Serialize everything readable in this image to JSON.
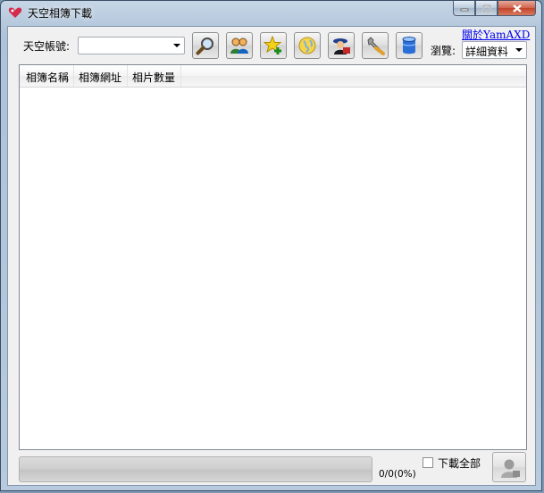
{
  "window": {
    "title": "天空相簿下載",
    "controls": [
      "minimize-icon",
      "maximize-icon",
      "close-icon"
    ]
  },
  "toolbar": {
    "account_label": "天空帳號:",
    "account_value": "",
    "buttons": [
      {
        "name": "search",
        "icon": "magnifier-icon"
      },
      {
        "name": "friends",
        "icon": "people-icon"
      },
      {
        "name": "favorite-add",
        "icon": "star-plus-icon"
      },
      {
        "name": "web",
        "icon": "globe-icon"
      },
      {
        "name": "user-agent",
        "icon": "agent-icon"
      },
      {
        "name": "settings",
        "icon": "wrench-icon"
      },
      {
        "name": "storage",
        "icon": "database-icon"
      }
    ],
    "about_link": "關於YamAXD",
    "view_label": "瀏覽:",
    "view_value": "詳細資料"
  },
  "list": {
    "columns": [
      "相簿名稱",
      "相簿網址",
      "相片數量"
    ],
    "rows": []
  },
  "status": {
    "progress_fraction": 0,
    "progress_text": "0/0(0%)",
    "download_all_label": "下載全部",
    "download_all_checked": false
  },
  "colors": {
    "title_bar": "#b5c8dc",
    "client_bg": "#f0f0f0",
    "link": "#0000ee"
  }
}
